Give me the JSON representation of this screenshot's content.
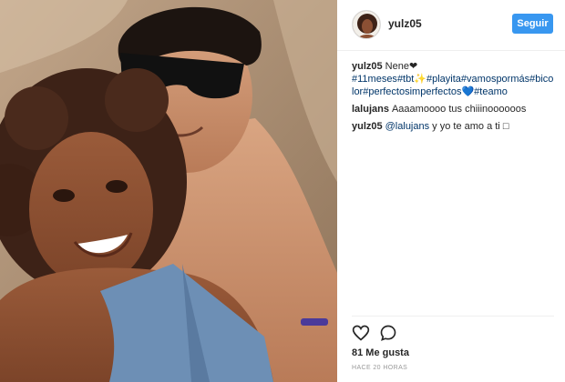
{
  "post": {
    "username": "yulz05",
    "follow_label": "Seguir",
    "icons": [
      "avatar",
      "heart-icon",
      "comment-icon"
    ]
  },
  "caption": {
    "username": "yulz05",
    "text": "Nene",
    "heart": "❤",
    "tags": [
      "#11meses",
      "#tbt",
      "✨",
      "#playita",
      "#vamospormás",
      "#bicolor",
      "#perfectosimperfectos",
      "💙",
      "#teamo"
    ]
  },
  "comments": [
    {
      "username": "lalujans",
      "text": "Aaaamoooo tus chiiinoooooos"
    },
    {
      "username": "yulz05",
      "mention": "@lalujans",
      "text": " y yo te amo a ti ",
      "emoji": "□"
    }
  ],
  "stats": {
    "likes": "81 Me gusta",
    "time": "HACE 20 HORAS"
  }
}
